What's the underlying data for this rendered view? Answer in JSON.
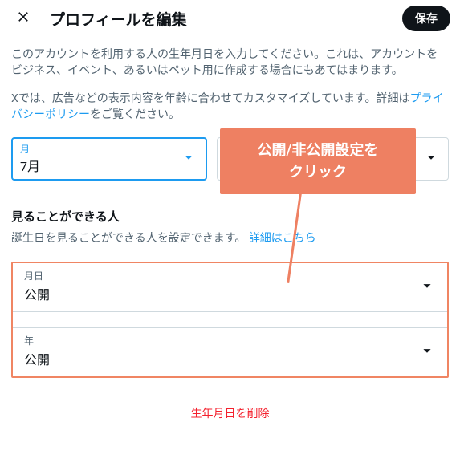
{
  "header": {
    "title": "プロフィールを編集",
    "save_label": "保存"
  },
  "description1": "このアカウントを利用する人の生年月日を入力してください。これは、アカウントをビジネス、イベント、あるいはペット用に作成する場合にもあてはまります。",
  "description2a": "Xでは、広告などの表示内容を年齢に合わせてカスタマイズしています。詳細は",
  "privacy_link": "プライバシーポリシー",
  "description2b": "をご覧ください。",
  "month": {
    "label": "月",
    "value": "7月"
  },
  "visibility": {
    "title": "見ることができる人",
    "desc": "誕生日を見ることができる人を設定できます。",
    "learn_more": "詳細はこちら",
    "month_day": {
      "label": "月日",
      "value": "公開"
    },
    "year": {
      "label": "年",
      "value": "公開"
    }
  },
  "delete_label": "生年月日を削除",
  "tooltip": {
    "line1": "公開/非公開設定を",
    "line2": "クリック"
  }
}
